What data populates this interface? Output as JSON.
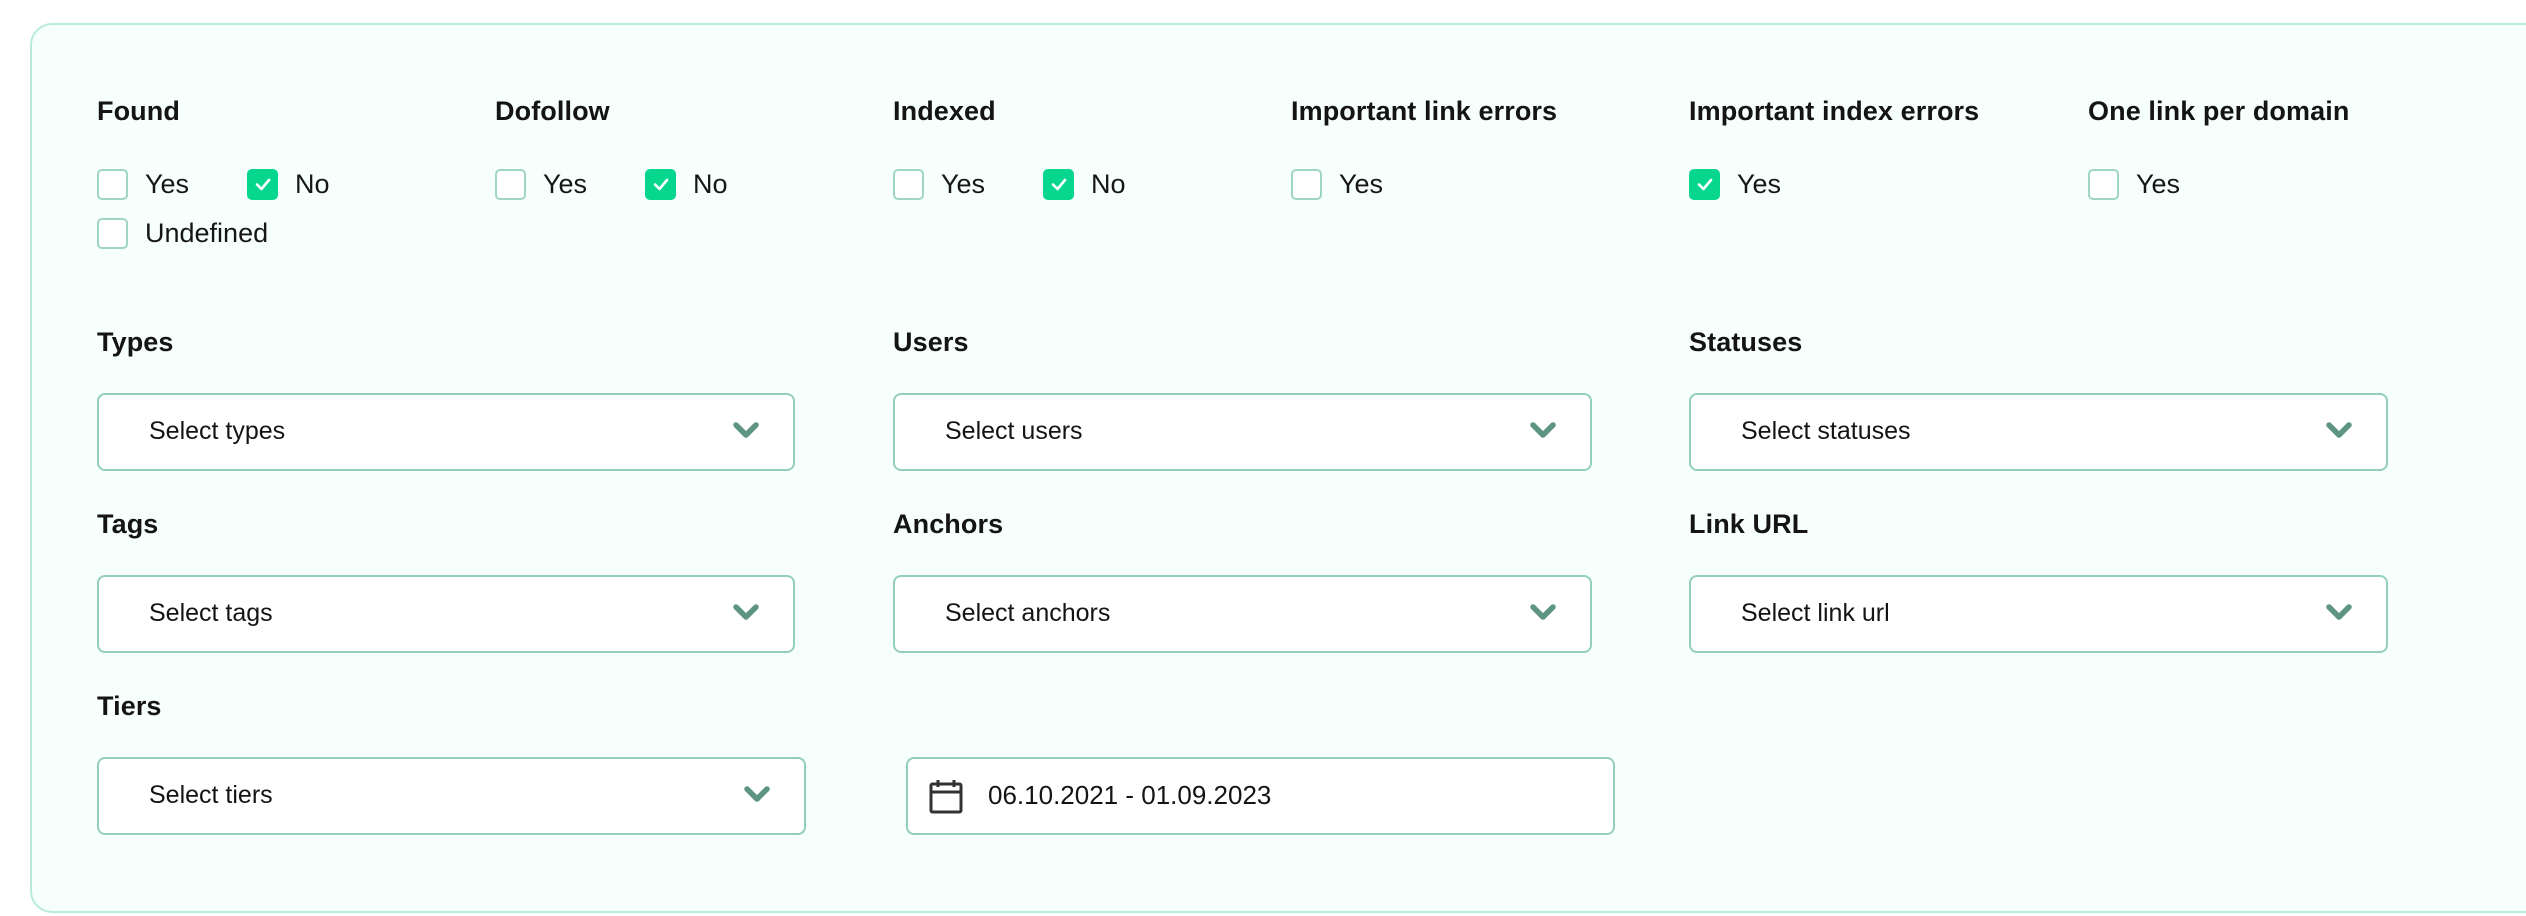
{
  "colors": {
    "panel_bg": "#f6fffc",
    "panel_border": "#b9ebd9",
    "checkbox_checked": "#07d68f",
    "checkbox_border": "#9fd6c2",
    "field_border": "#93cfba",
    "chevron": "#5e9483"
  },
  "checkbox_groups": [
    {
      "label": "Found",
      "options": [
        {
          "label": "Yes",
          "checked": false
        },
        {
          "label": "No",
          "checked": true
        },
        {
          "label": "Undefined",
          "checked": false
        }
      ]
    },
    {
      "label": "Dofollow",
      "options": [
        {
          "label": "Yes",
          "checked": false
        },
        {
          "label": "No",
          "checked": true
        }
      ]
    },
    {
      "label": "Indexed",
      "options": [
        {
          "label": "Yes",
          "checked": false
        },
        {
          "label": "No",
          "checked": true
        }
      ]
    },
    {
      "label": "Important link errors",
      "options": [
        {
          "label": "Yes",
          "checked": false
        }
      ]
    },
    {
      "label": "Important index errors",
      "options": [
        {
          "label": "Yes",
          "checked": true
        }
      ]
    },
    {
      "label": "One link per domain",
      "options": [
        {
          "label": "Yes",
          "checked": false
        }
      ]
    }
  ],
  "selects": {
    "types": {
      "label": "Types",
      "placeholder": "Select types",
      "icon": "chevron-down-icon"
    },
    "users": {
      "label": "Users",
      "placeholder": "Select users",
      "icon": "chevron-down-icon"
    },
    "statuses": {
      "label": "Statuses",
      "placeholder": "Select statuses",
      "icon": "chevron-down-icon"
    },
    "tags": {
      "label": "Tags",
      "placeholder": "Select tags",
      "icon": "chevron-down-icon"
    },
    "anchors": {
      "label": "Anchors",
      "placeholder": "Select anchors",
      "icon": "chevron-down-icon"
    },
    "link_url": {
      "label": "Link URL",
      "placeholder": "Select link url",
      "icon": "chevron-down-icon"
    },
    "tiers": {
      "label": "Tiers",
      "placeholder": "Select tiers",
      "icon": "chevron-down-icon"
    }
  },
  "date_range": {
    "icon": "calendar-icon",
    "value": "06.10.2021 - 01.09.2023"
  }
}
